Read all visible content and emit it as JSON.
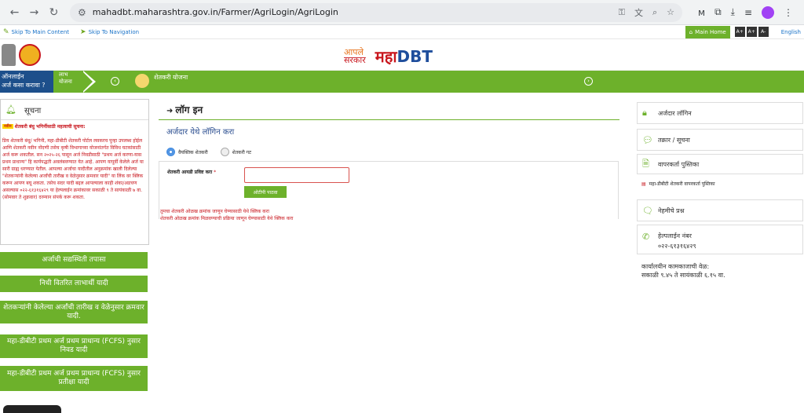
{
  "browser": {
    "url": "mahadbt.maharashtra.gov.in/Farmer/AgriLogin/AgriLogin"
  },
  "skip": {
    "main_content": "Skip To Main Content",
    "navigation": "Skip To Navigation",
    "main_home": "Main Home",
    "font_larger": "A+",
    "font_normal": "A+",
    "font_smaller": "A-",
    "language": "English"
  },
  "logos": {
    "aaple_line1": "आपले",
    "aaple_line2": "सरकार",
    "maha": "महा",
    "dbt": "DBT"
  },
  "nav": {
    "online_line1": "ऑनलाईन",
    "online_line2": "अर्ज कसा करावा ?",
    "labh_line1": "लाभ",
    "labh_line2": "योजना",
    "prev": "‹",
    "next": "›",
    "shetkari_yojana": "शेतकरी योजना"
  },
  "notice": {
    "title": "सूचना",
    "new_tag": "नवीन",
    "headline": "शेतकरी बंधु भगिनींसाठी महत्वाची सुचना:",
    "body": "प्रिय शेतकरी बंधू/ भगिनी, महा-डीबीटी शेतकरी पोर्टल लवकरच पुन्हा उपलब्ध होईल आणि शेतकरी नवीन नोंदणी तसेच कृषी विभागाच्या योजनांतर्गत विविध घटकांसाठी अर्ज करू शकतील. सन २०२५-२६ पासून अर्ज निवडीसाठी \"प्रथम अर्ज करणा-यास प्रथम प्राधान्य\" हि कार्यपद्धती अवलंबवण्यात येत आहे. आपण यापूर्वी केलेले अर्ज या सारी ग्राह्य धरण्यात येतील. आपल्या अर्जाचा यादीतील अनुक्रमांक खाली दिलेल्या \"शेतकऱ्यांनी केलेल्या अर्जांची तारीख व वेळेनुसार क्रमवार यादी\" या लिंक वर क्लिक करून आपण बघू शकता. तसेच सदर यादी बद्दल आपल्याला काही शंका/अडचण असल्यास ०२२-६१३१६४२९ या हेल्पलाईन क्रमांकावर सकाळी ९ ते सायंकाळी ७ वा. (सोमवार ते शुक्रवार) दरम्यान संपर्क करू शकता."
  },
  "left_buttons": [
    "अर्जाची सद्यस्थिती तपासा",
    "निधी वितरित लाभार्थी यादी",
    "शेतकऱ्यांनी केलेल्या अर्जांची तारीख व वेळेनुसार क्रमवार यादी.",
    "महा-डीबीटी प्रथम अर्ज प्रथम प्राधान्य (FCFS) नुसार निवड यादी",
    "महा-डीबीटी प्रथम अर्ज प्रथम प्राधान्य (FCFS) नुसार प्रतीक्षा यादी"
  ],
  "login": {
    "title": "लॉग इन",
    "subtitle": "अर्जदार येथे लॉगिन करा",
    "radio_individual": "वैयक्तिक शेतकरी",
    "radio_group": "शेतकरी गट",
    "id_label": "शेतकरी आयडी प्रविष्ट करा",
    "required": "*",
    "id_value": "",
    "otp_button": "ओटीपी पाठवा",
    "link1": "तुमचा शेतकरी ओळख क्रमांक जाणून घेण्यासाठी येथे क्लिक करा",
    "link2": "शेतकरी ओळख क्रमांक मिळवण्याची प्रक्रिया जाणून घेण्यासाठी येथे क्लिक करा"
  },
  "right": {
    "applicant_login": "अर्जदार लॉगिन",
    "complaint": "तक्रार / सूचना",
    "user_manual": "वापरकर्ता पुस्तिका",
    "manual_link": "महा-डीबीटी शेतकरी वापरकर्ता पुस्तिका",
    "faq": "नेहमीचे प्रश्न",
    "helpline_label": "हेल्पलाईन नंबर",
    "helpline_number": "०२२-६१३१६४२९",
    "office_hours_label": "कार्यालयीन कामकाजाची वेळ:",
    "office_hours": "सकाळी ९.४५ ते सायंकाळी ६.१५ वा."
  }
}
